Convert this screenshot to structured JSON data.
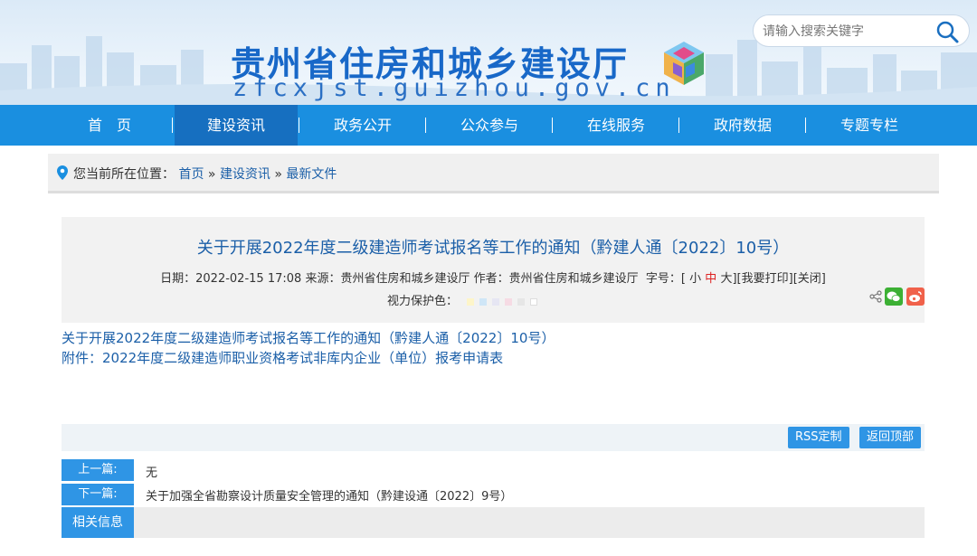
{
  "header": {
    "site_title": "贵州省住房和城乡建设厅",
    "site_domain": "zfcxjst.guizhou.gov.cn",
    "search_placeholder": "请输入搜索关键字"
  },
  "nav": {
    "items": [
      "首　页",
      "建设资讯",
      "政务公开",
      "公众参与",
      "在线服务",
      "政府数据",
      "专题专栏"
    ],
    "active": "建设资讯",
    "separator": "|"
  },
  "breadcrumb": {
    "prefix": "您当前所在位置：",
    "home": "首页",
    "sep": "»",
    "section": "建设资讯",
    "current": "最新文件"
  },
  "article": {
    "title": "关于开展2022年度二级建造师考试报名等工作的通知（黔建人通〔2022〕10号）",
    "date_label": "日期：",
    "date": "2022-02-15 17:08",
    "source_label": "来源：",
    "source": "贵州省住房和城乡建设厅",
    "author_label": "作者：",
    "author": "贵州省住房和城乡建设厅",
    "font_label": "字号：",
    "bracket_open": "[",
    "bracket_close": "]",
    "size_small": "小",
    "size_medium": "中",
    "size_large": "大",
    "print": "[我要打印]",
    "close": "[关闭]",
    "eye_protect_label": "视力保护色：",
    "swatch_colors": [
      "#fdf5c9",
      "#cfe6f7",
      "#e6e6f3",
      "#f6dbe4",
      "#e6e6e6",
      "#ffffff"
    ]
  },
  "body": {
    "link1": "关于开展2022年度二级建造师考试报名等工作的通知（黔建人通〔2022〕10号）",
    "link2": "附件：2022年度二级建造师职业资格考试非库内企业（单位）报考申请表"
  },
  "actions": {
    "rss": "RSS定制",
    "top": "返回顶部"
  },
  "pager": {
    "prev_label": "上一篇:",
    "prev_value": "无",
    "next_label": "下一篇:",
    "next_value": "关于加强全省勘察设计质量安全管理的通知（黔建设通〔2022〕9号）",
    "related_label": "相关信息"
  },
  "colors": {
    "nav": "#1a8fe0",
    "nav_active": "#166fc0",
    "link": "#1b5fa8",
    "button": "#2f95e5"
  }
}
